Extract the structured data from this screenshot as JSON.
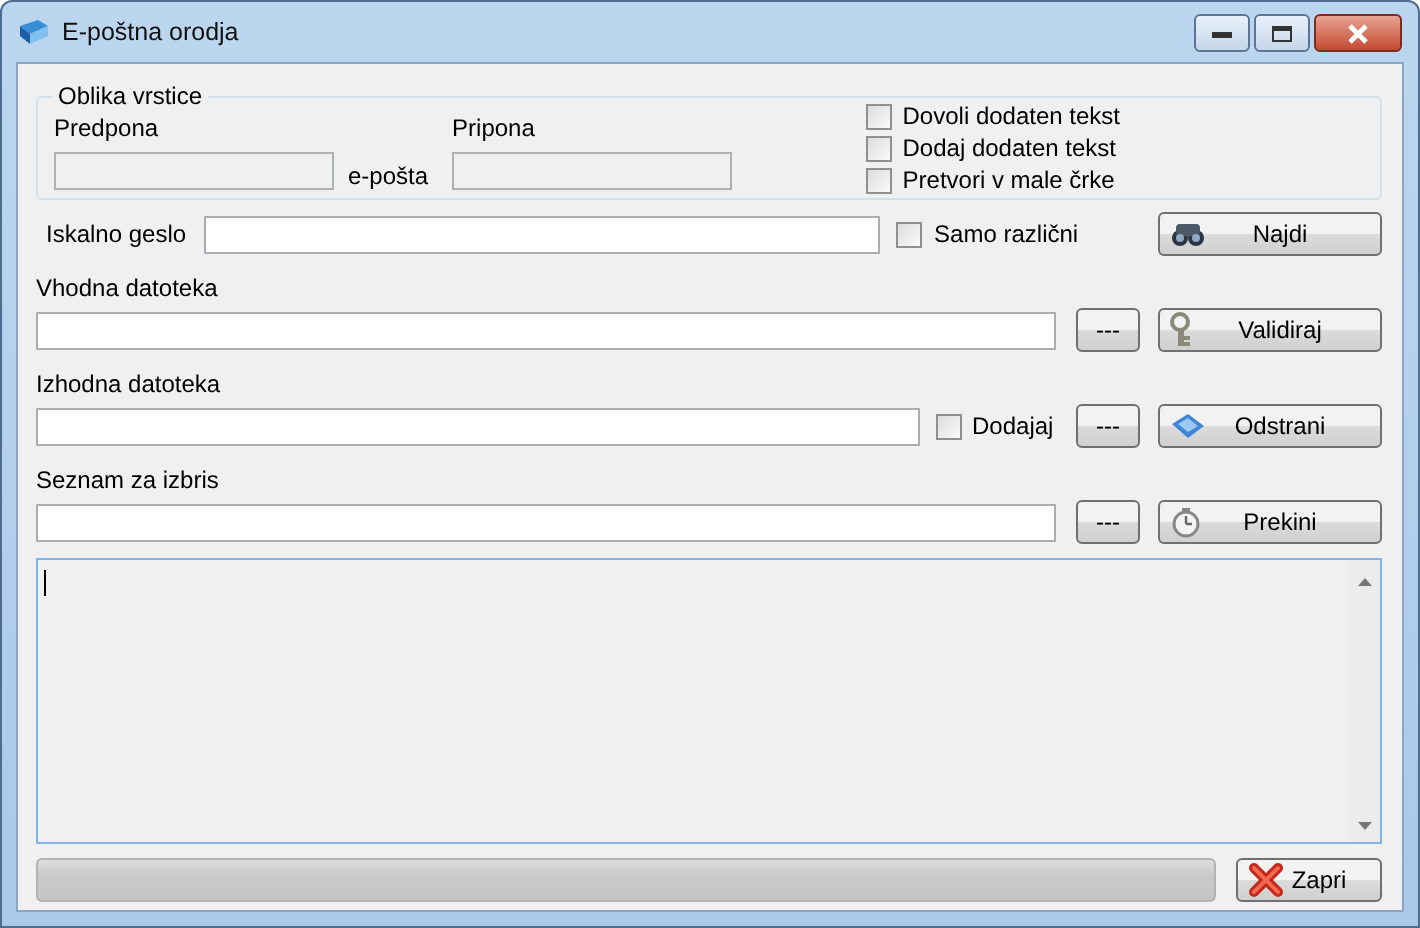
{
  "window": {
    "title": "E-poštna orodja"
  },
  "line_format": {
    "title": "Oblika vrstice",
    "prefix": {
      "label": "Predpona",
      "disabled": true
    },
    "middle": "e-pošta",
    "suffix": {
      "label": "Pripona",
      "disabled": true
    },
    "options": [
      {
        "label": "Dovoli dodaten tekst",
        "checked": false
      },
      {
        "label": "Dodaj dodaten tekst",
        "checked": false
      },
      {
        "label": "Pretvori v male črke",
        "checked": false
      }
    ]
  },
  "search": {
    "label": "Iskalno geslo",
    "distinct": {
      "label": "Samo različni",
      "checked": false
    },
    "button": "Najdi"
  },
  "input_file": {
    "label": "Vhodna datoteka",
    "browse": "---",
    "button": "Validiraj"
  },
  "output_file": {
    "label": "Izhodna datoteka",
    "append": {
      "label": "Dodajaj",
      "checked": false
    },
    "browse": "---",
    "button": "Odstrani"
  },
  "delete_list": {
    "label": "Seznam za izbris",
    "browse": "---",
    "button": "Prekini"
  },
  "progress": {
    "level": 0
  },
  "close_button": "Zapri"
}
